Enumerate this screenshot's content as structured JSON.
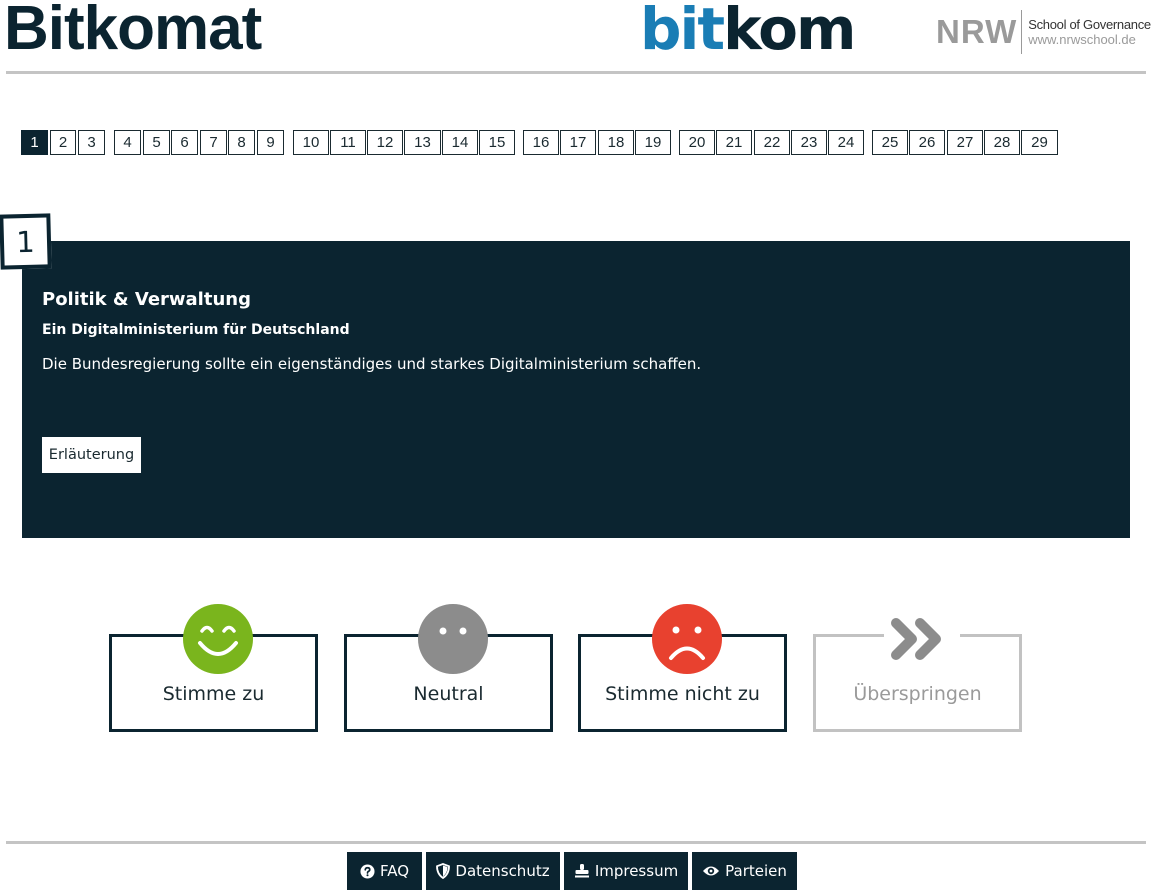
{
  "header": {
    "app_title": "Bitkomat",
    "logo_bit": "bit",
    "logo_kom": "kom",
    "nrw_abbr": "NRW",
    "nrw_title": "School of Governance",
    "nrw_url": "www.nrwschool.de"
  },
  "pager": {
    "pages": [
      "1",
      "2",
      "3",
      "4",
      "5",
      "6",
      "7",
      "8",
      "9",
      "10",
      "11",
      "12",
      "13",
      "14",
      "15",
      "16",
      "17",
      "18",
      "19",
      "20",
      "21",
      "22",
      "23",
      "24",
      "25",
      "26",
      "27",
      "28",
      "29"
    ],
    "current": "1"
  },
  "question": {
    "number": "1",
    "category": "Politik & Verwaltung",
    "title": "Ein Digitalministerium für Deutschland",
    "text": "Die Bundesregierung sollte ein eigenständiges und starkes Digitalministerium schaffen.",
    "explain_label": "Erläuterung"
  },
  "answers": [
    {
      "label": "Stimme zu",
      "icon": "happy-face-icon",
      "color": "#7ab51d"
    },
    {
      "label": "Neutral",
      "icon": "neutral-face-icon",
      "color": "#8c8c8c"
    },
    {
      "label": "Stimme nicht zu",
      "icon": "sad-face-icon",
      "color": "#e8412f"
    },
    {
      "label": "Überspringen",
      "icon": "double-chevron-right-icon",
      "color": "#8c8c8c"
    }
  ],
  "footer": {
    "faq": "FAQ",
    "privacy": "Datenschutz",
    "imprint": "Impressum",
    "parties": "Parteien"
  },
  "colors": {
    "dark": "#0b2430",
    "bitkom_blue": "#1a7db5",
    "agree": "#7ab51d",
    "neutral": "#8c8c8c",
    "disagree": "#e8412f"
  }
}
